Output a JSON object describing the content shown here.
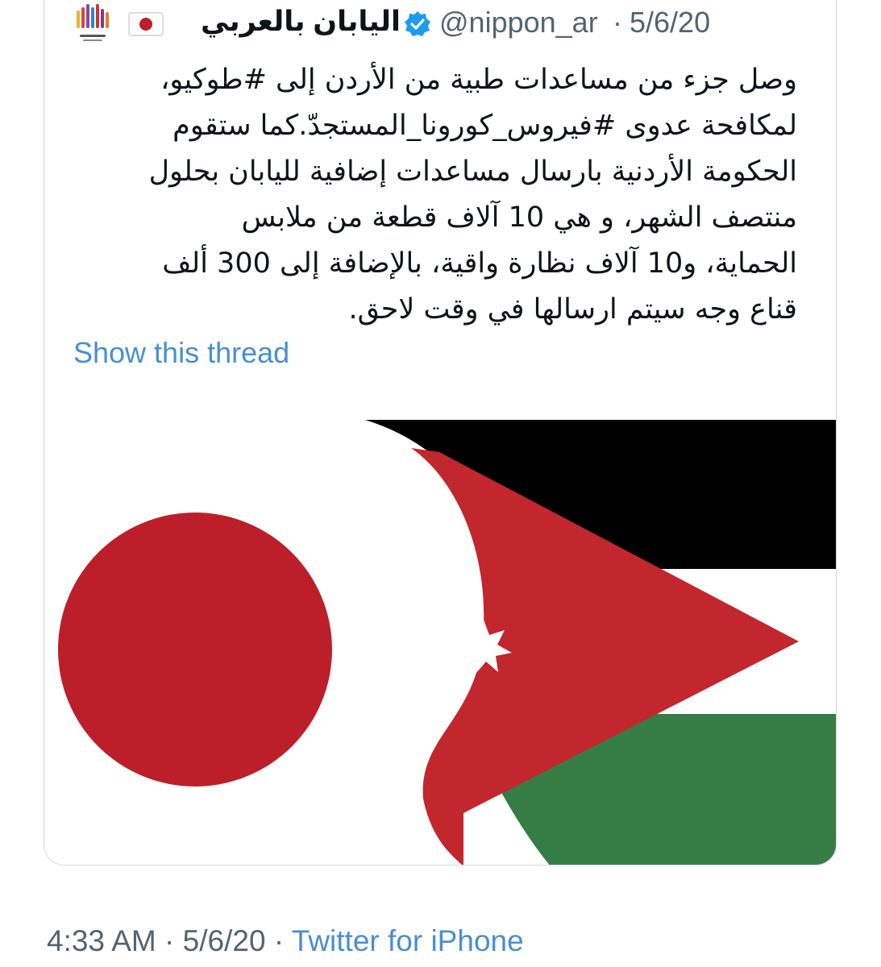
{
  "tweet": {
    "display_name": "اليابان بالعربي",
    "handle": "@nippon_ar",
    "separator": "·",
    "date": "5/6/20",
    "avatar_icon": "nippon-ar-logo",
    "flag_emoji": "japan-flag",
    "verified_icon": "verified-badge",
    "text_lines": [
      "وصل جزء من مساعدات طبية من الأردن إلى #طوكيو،",
      "لمكافحة عدوى #فيروس_كورونا_المستجدّ.كما ستقوم",
      "الحكومة الأردنية بارسال مساعدات إضافية لليابان بحلول",
      "منتصف الشهر، و هي 10 آلاف قطعة من ملابس",
      "الحماية، و10 آلاف نظارة واقية، بالإضافة إلى 300 ألف",
      "قناع وجه سيتم ارسالها في وقت لاحق."
    ],
    "show_thread": "Show this thread",
    "media": {
      "image_description_icon": "japan-jordan-flags-image",
      "colors": {
        "japan_red": "#bc1f2a",
        "jordan_red": "#c1272d",
        "black": "#000000",
        "green": "#367c45",
        "white": "#ffffff"
      }
    }
  },
  "footer": {
    "time": "4:33 AM",
    "separator": "·",
    "date": "5/6/20",
    "source": "Twitter for iPhone"
  },
  "colors": {
    "text": "#0f1419",
    "muted": "#536471",
    "link": "#4a8fd0",
    "verified": "#1d9bf0",
    "border": "#cfd9de"
  }
}
